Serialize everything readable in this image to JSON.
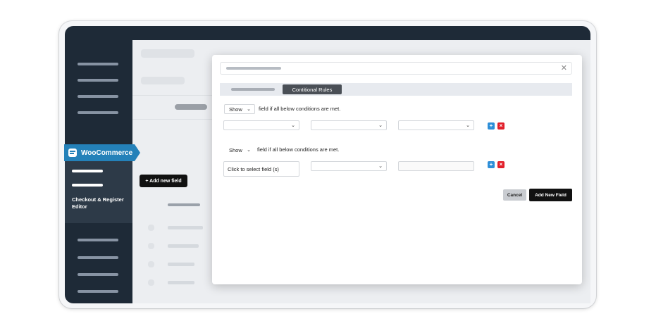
{
  "sidebar": {
    "brand_label": "WooCommerce",
    "sub_label": "Checkout & Register Editor"
  },
  "background": {
    "add_field_label": "+ Add new field"
  },
  "modal": {
    "close_glyph": "✕",
    "tabs": {
      "active_label": "Contitional Rules"
    },
    "rule_row_1": {
      "action_value": "Show",
      "condition_text": "field if all below conditions are met."
    },
    "rule_row_2": {
      "action_value": "Show",
      "condition_text": "field if all below conditions are met.",
      "field_picker_label": "Click to select field (s)"
    },
    "buttons": {
      "add_glyph": "+",
      "delete_glyph": "×",
      "cancel_label": "Cancel",
      "add_new_field_label": "Add New Field"
    }
  },
  "colors": {
    "sidebar_dark": "#1e2a37",
    "woocommerce_blue": "#2481b9",
    "add_button_blue": "#2f8fd8",
    "delete_button_red": "#e2202b",
    "primary_black": "#111111"
  }
}
